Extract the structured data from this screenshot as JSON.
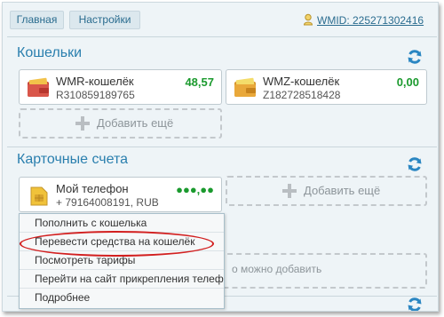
{
  "nav": {
    "home_label": "Главная",
    "settings_label": "Настройки",
    "wmid_label": "WMID: 225271302416"
  },
  "wallets": {
    "title": "Кошельки",
    "items": [
      {
        "name": "WMR-кошелёк",
        "number": "R310859189765",
        "amount": "48,57"
      },
      {
        "name": "WMZ-кошелёк",
        "number": "Z182728518428",
        "amount": "0,00"
      }
    ],
    "add_label": "Добавить ещё"
  },
  "cards": {
    "title": "Карточные счета",
    "item": {
      "name": "Мой телефон",
      "number": "+ 79164008191, RUB",
      "amount": "●●●,●●"
    },
    "add_label": "Добавить ещё",
    "faded_text": "о можно добавить"
  },
  "context_menu": {
    "items": [
      "Пополнить с кошелька",
      "Перевести средства на кошелёк",
      "Посмотреть тарифы",
      "Перейти на сайт прикрепления телеф",
      "Подробнее"
    ]
  },
  "colors": {
    "accent": "#2a7fae",
    "positive": "#1b9a2e",
    "highlight": "#d21f1f"
  }
}
